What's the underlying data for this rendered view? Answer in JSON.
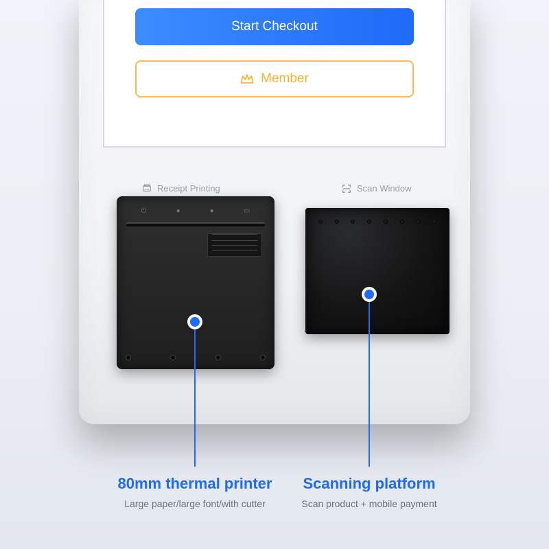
{
  "screen": {
    "checkout_label": "Start Checkout",
    "member_label": "Member"
  },
  "body_labels": {
    "receipt": "Receipt Printing",
    "scan": "Scan Window"
  },
  "callouts": {
    "printer": {
      "title": "80mm thermal printer",
      "subtitle": "Large paper/large font/with cutter"
    },
    "scanner": {
      "title": "Scanning platform",
      "subtitle": "Scan product + mobile payment"
    }
  }
}
